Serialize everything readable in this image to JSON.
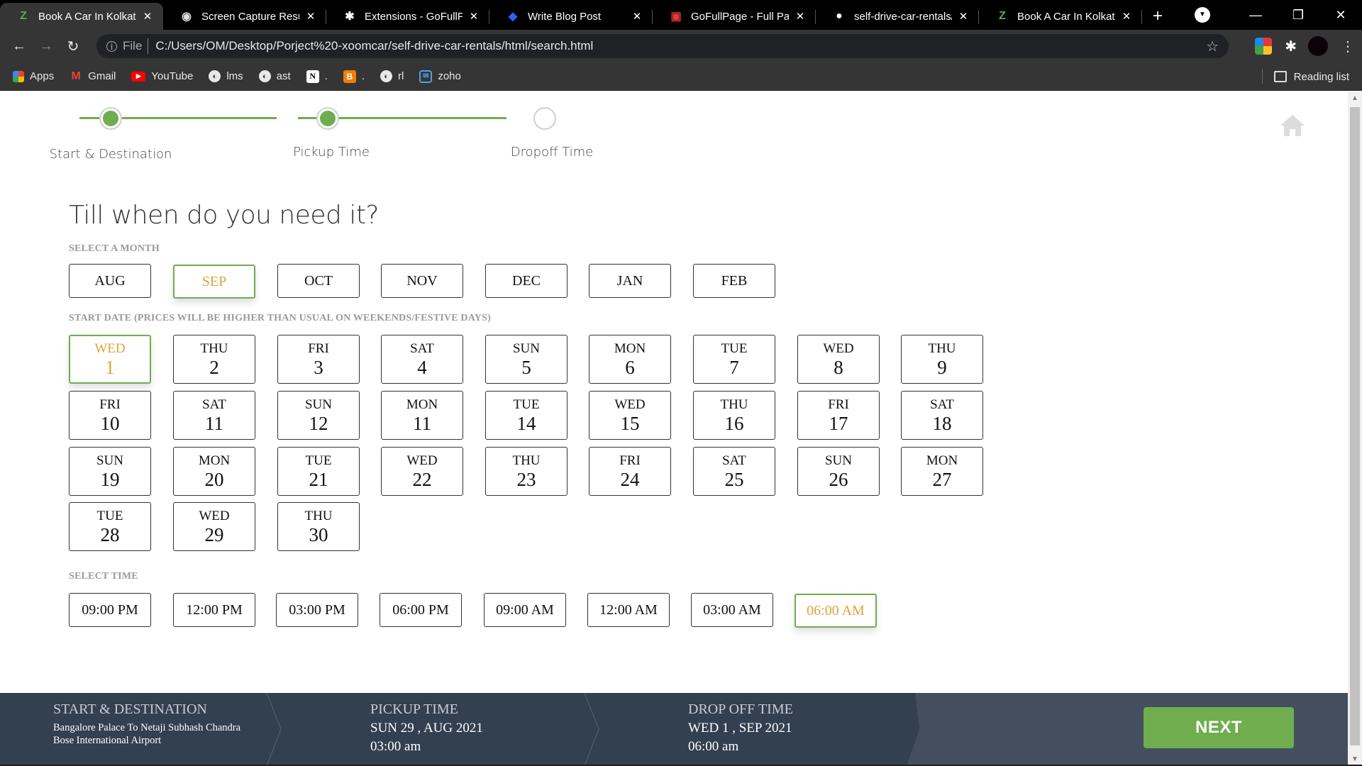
{
  "browser": {
    "tabs": [
      {
        "title": "Book A Car In Kolkata",
        "icon": "zoomcar-logo-icon",
        "active": true
      },
      {
        "title": "Screen Capture Result",
        "icon": "camera-icon",
        "active": false
      },
      {
        "title": "Extensions - GoFullPage",
        "icon": "puzzle-icon",
        "active": false
      },
      {
        "title": "Write Blog Post",
        "icon": "hashnode-icon",
        "active": false
      },
      {
        "title": "GoFullPage - Full Page",
        "icon": "chrome-webstore-icon",
        "active": false
      },
      {
        "title": "self-drive-car-rentals/s",
        "icon": "github-icon",
        "active": false
      },
      {
        "title": "Book A Car In Kolkata",
        "icon": "zoomcar-logo-icon",
        "active": false
      }
    ],
    "new_tab_label": "+",
    "address": {
      "scheme_label": "File",
      "url": "C:/Users/OM/Desktop/Porject%20-xoomcar/self-drive-car-rentals/html/search.html"
    },
    "bookmarks": [
      {
        "label": "Apps",
        "icon": "apps-grid-icon"
      },
      {
        "label": "Gmail",
        "icon": "gmail-icon"
      },
      {
        "label": "YouTube",
        "icon": "youtube-icon"
      },
      {
        "label": "lms",
        "icon": "globe-icon"
      },
      {
        "label": "ast",
        "icon": "globe-icon"
      },
      {
        "label": ".",
        "icon": "notion-icon"
      },
      {
        "label": ".",
        "icon": "blogger-icon"
      },
      {
        "label": "rl",
        "icon": "globe-icon"
      },
      {
        "label": "zoho",
        "icon": "zoho-mail-icon"
      }
    ],
    "reading_list_label": "Reading list"
  },
  "progress": {
    "steps": [
      {
        "label": "Start & Destination",
        "done": true
      },
      {
        "label": "Pickup Time",
        "done": true
      },
      {
        "label": "Dropoff Time",
        "done": false
      }
    ]
  },
  "main": {
    "heading": "Till when do you need it?",
    "month_label": "SELECT A MONTH",
    "months": [
      "AUG",
      "SEP",
      "OCT",
      "NOV",
      "DEC",
      "JAN",
      "FEB"
    ],
    "selected_month": "SEP",
    "date_label": "START DATE (PRICES WILL BE HIGHER THAN USUAL ON WEEKENDS/FESTIVE DAYS)",
    "dates": [
      {
        "dow": "WED",
        "day": "1"
      },
      {
        "dow": "THU",
        "day": "2"
      },
      {
        "dow": "FRI",
        "day": "3"
      },
      {
        "dow": "SAT",
        "day": "4"
      },
      {
        "dow": "SUN",
        "day": "5"
      },
      {
        "dow": "MON",
        "day": "6"
      },
      {
        "dow": "TUE",
        "day": "7"
      },
      {
        "dow": "WED",
        "day": "8"
      },
      {
        "dow": "THU",
        "day": "9"
      },
      {
        "dow": "FRI",
        "day": "10"
      },
      {
        "dow": "SAT",
        "day": "11"
      },
      {
        "dow": "SUN",
        "day": "12"
      },
      {
        "dow": "MON",
        "day": "11"
      },
      {
        "dow": "TUE",
        "day": "14"
      },
      {
        "dow": "WED",
        "day": "15"
      },
      {
        "dow": "THU",
        "day": "16"
      },
      {
        "dow": "FRI",
        "day": "17"
      },
      {
        "dow": "SAT",
        "day": "18"
      },
      {
        "dow": "SUN",
        "day": "19"
      },
      {
        "dow": "MON",
        "day": "20"
      },
      {
        "dow": "TUE",
        "day": "21"
      },
      {
        "dow": "WED",
        "day": "22"
      },
      {
        "dow": "THU",
        "day": "23"
      },
      {
        "dow": "FRI",
        "day": "24"
      },
      {
        "dow": "SAT",
        "day": "25"
      },
      {
        "dow": "SUN",
        "day": "26"
      },
      {
        "dow": "MON",
        "day": "27"
      },
      {
        "dow": "TUE",
        "day": "28"
      },
      {
        "dow": "WED",
        "day": "29"
      },
      {
        "dow": "THU",
        "day": "30"
      }
    ],
    "selected_date_index": 0,
    "time_label": "SELECT TIME",
    "times": [
      "09:00 PM",
      "12:00 PM",
      "03:00 PM",
      "06:00 PM",
      "09:00 AM",
      "12:00 AM",
      "03:00 AM",
      "06:00 AM"
    ],
    "selected_time": "06:00 AM"
  },
  "summary": {
    "start_title": "START & DESTINATION",
    "start_value": "Bangalore Palace To Netaji Subhash Chandra Bose International Airport",
    "pickup_title": "PICKUP TIME",
    "pickup_date": "SUN 29 , AUG 2021",
    "pickup_time": "03:00 am",
    "drop_title": "DROP OFF TIME",
    "drop_date": "WED 1 , SEP 2021",
    "drop_time": "06:00 am",
    "next_label": "NEXT"
  },
  "colors": {
    "accent_green": "#6fad4f",
    "selected_text": "#dda33a",
    "summary_bg": "#334050"
  }
}
